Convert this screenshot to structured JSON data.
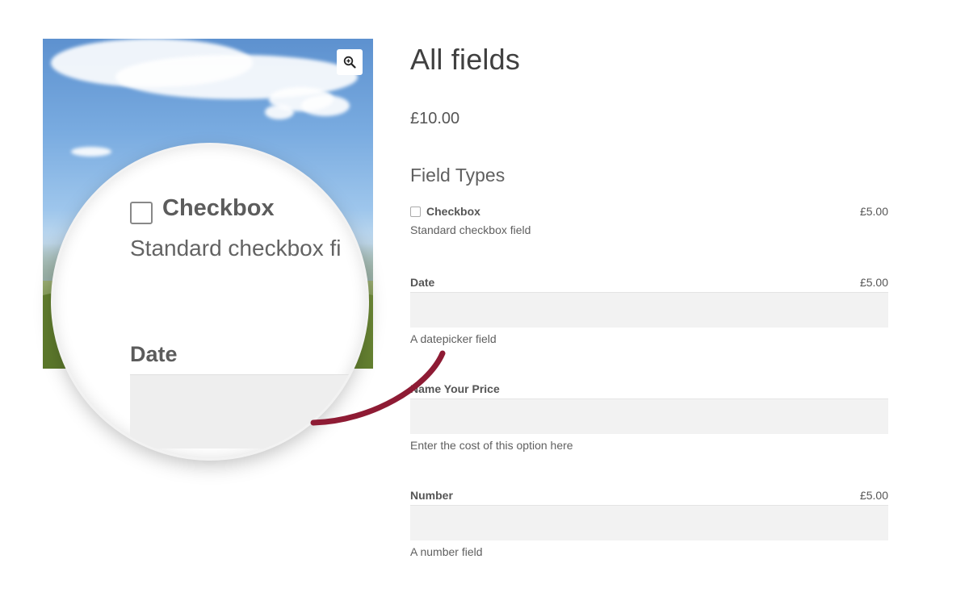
{
  "product": {
    "title": "All fields",
    "price": "£10.00",
    "group_heading": "Field Types"
  },
  "fields": {
    "checkbox": {
      "label": "Checkbox",
      "price": "£5.00",
      "description": "Standard checkbox field"
    },
    "date": {
      "label": "Date",
      "price": "£5.00",
      "description": "A datepicker field"
    },
    "name_your_price": {
      "label": "Name Your Price",
      "description": "Enter the cost of this option here"
    },
    "number": {
      "label": "Number",
      "price": "£5.00",
      "description": "A number field"
    }
  },
  "magnifier": {
    "checkbox_label": "Checkbox",
    "checkbox_description": "Standard checkbox fi",
    "date_label": "Date"
  },
  "icons": {
    "zoom": "zoom-in-icon"
  },
  "colors": {
    "pointer": "#8e1b34",
    "input_background": "#f2f2f2"
  }
}
